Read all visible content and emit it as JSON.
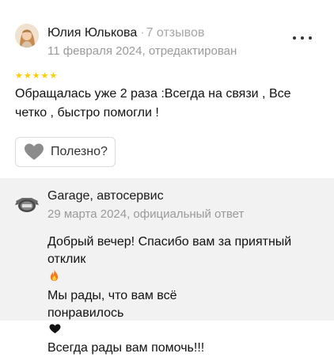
{
  "review": {
    "author_name": "Юлия Юлькова",
    "separator": "·",
    "reviews_count": "7 отзывов",
    "date_meta": "11 февраля 2024, отредактирован",
    "rating": 5,
    "star_glyph": "★",
    "text": "Обращалась уже 2 раза :Всегда на связи , Все четко , быстро помогли !",
    "helpful_label": "Полезно?",
    "icons": {
      "more": "more-dots-icon",
      "helpful": "heart-icon",
      "avatar": "user-avatar"
    }
  },
  "reply": {
    "business_name": "Garage, автосервис",
    "date_meta": "29 марта 2024, официальный ответ",
    "lines": {
      "l1": "Добрый вечер! Спасибо вам за приятный",
      "l2a": "отклик",
      "l2b": "Мы рады, что вам всё",
      "l3": "понравилось",
      "l4": "Всегда рады вам помочь!!!"
    },
    "icons": {
      "fire": "fire-emoji-icon",
      "heart": "black-heart-icon",
      "logo": "garage-logo-icon"
    }
  },
  "colors": {
    "star": "#ffcc00",
    "reply_background": "#f2f2f2",
    "meta_text": "#9a9a9a"
  }
}
